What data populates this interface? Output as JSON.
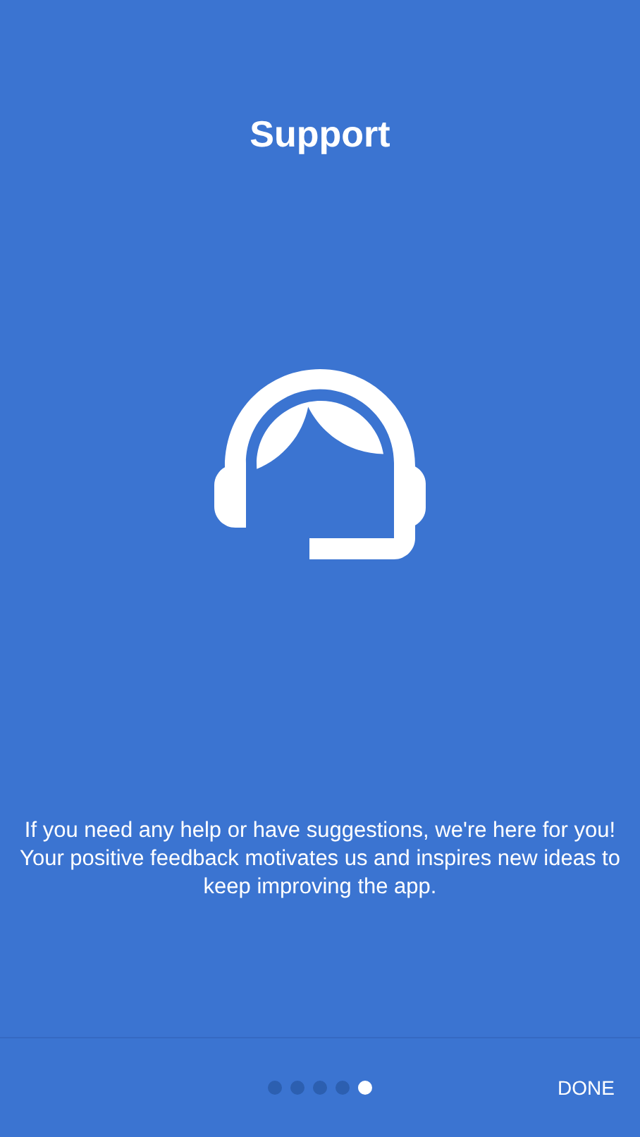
{
  "title": "Support",
  "message": "If you need any help or have suggestions, we're here for you! Your positive feedback motivates us and inspires new ideas to keep improving the app.",
  "pages": [
    {
      "selected": false
    },
    {
      "selected": false
    },
    {
      "selected": false
    },
    {
      "selected": false
    },
    {
      "selected": true
    }
  ],
  "done_button": "DONE"
}
